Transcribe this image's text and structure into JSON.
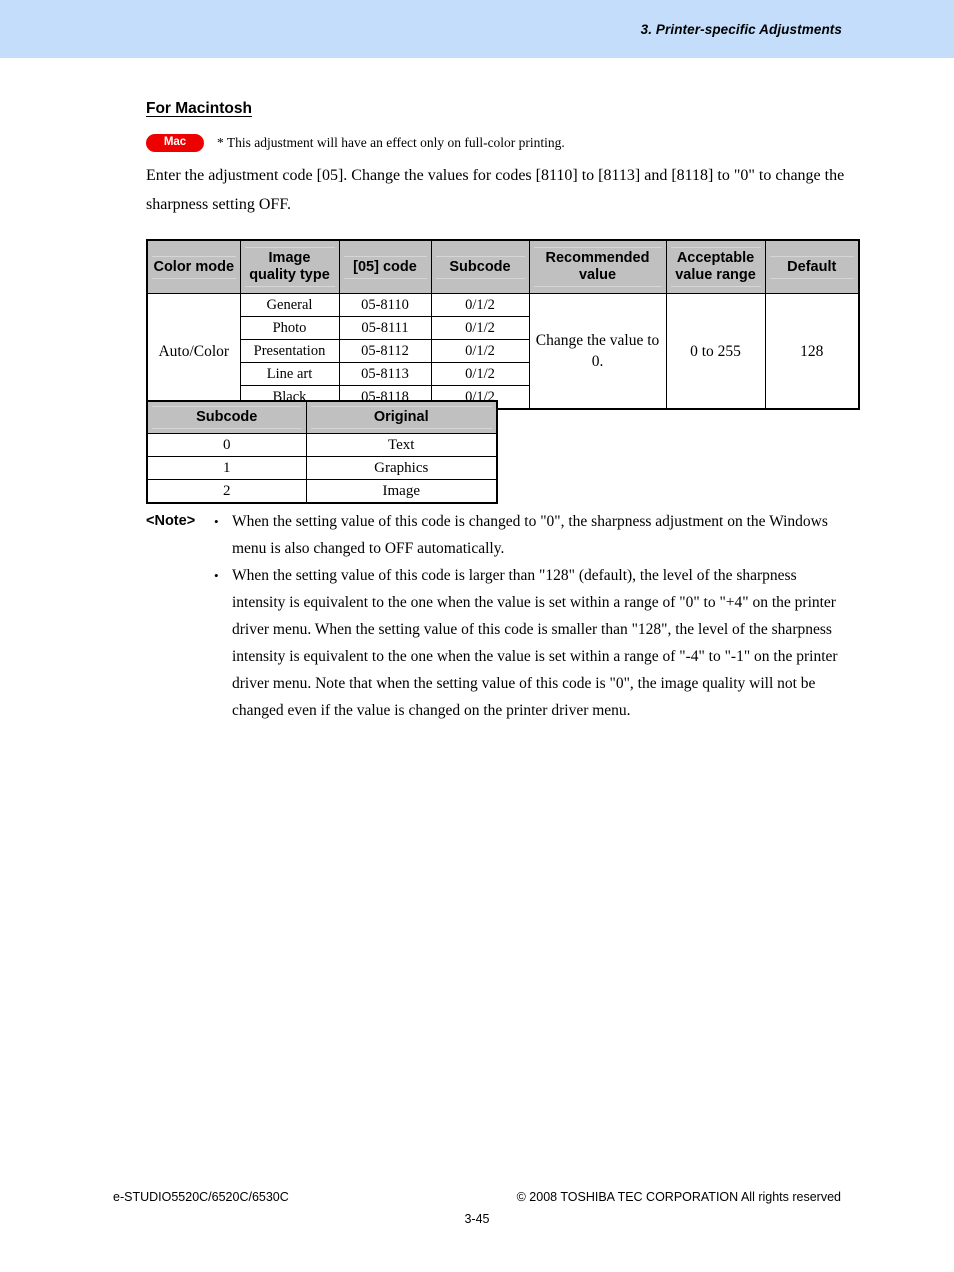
{
  "header": {
    "chapter_title": "3. Printer-specific Adjustments",
    "band_color": "#c3ddfb"
  },
  "section": {
    "heading": "For Macintosh",
    "badge_label": "Mac",
    "badge_color": "#ef0000",
    "badge_note": "* This adjustment will have an effect only on full-color printing.",
    "paragraph": "Enter the adjustment code [05]. Change the values for codes [8110] to [8113] and [8118] to \"0\" to change the sharpness setting OFF."
  },
  "main_table": {
    "headers": [
      "Color mode",
      "Image quality type",
      "[05] code",
      "Subcode",
      "Recommended value",
      "Acceptable value range",
      "Default"
    ],
    "header_bg": "#c0c0c0",
    "color_mode": "Auto/Color",
    "recommended_value": "Change the value to 0.",
    "acceptable_value_range": "0 to 255",
    "default": "128",
    "rows": [
      {
        "image_quality_type": "General",
        "code": "05-8110",
        "subcode": "0/1/2"
      },
      {
        "image_quality_type": "Photo",
        "code": "05-8111",
        "subcode": "0/1/2"
      },
      {
        "image_quality_type": "Presentation",
        "code": "05-8112",
        "subcode": "0/1/2"
      },
      {
        "image_quality_type": "Line art",
        "code": "05-8113",
        "subcode": "0/1/2"
      },
      {
        "image_quality_type": "Black",
        "code": "05-8118",
        "subcode": "0/1/2"
      }
    ]
  },
  "subcode_table": {
    "headers": [
      "Subcode",
      "Original"
    ],
    "header_bg": "#c0c0c0",
    "rows": [
      {
        "subcode": "0",
        "original": "Text"
      },
      {
        "subcode": "1",
        "original": "Graphics"
      },
      {
        "subcode": "2",
        "original": "Image"
      }
    ]
  },
  "note": {
    "label": "<Note>",
    "bullet_glyph": "•",
    "items": [
      "When the setting value of this code is changed to \"0\", the sharpness adjustment on the Windows menu is also changed to OFF automatically.",
      "When the setting value of this code is larger than \"128\" (default), the level of the sharpness intensity is equivalent to the one when the value is set within a range of \"0\" to \"+4\" on the printer driver menu. When the setting value of this code is smaller than \"128\", the level of the sharpness intensity is equivalent to the one when the value is set within a range of \"-4\" to \"-1\" on the printer driver menu. Note that when the setting value of this code is \"0\", the image quality will not be changed even if the value is changed on the printer driver menu."
    ]
  },
  "footer": {
    "model": "e-STUDIO5520C/6520C/6530C",
    "copyright": "© 2008 TOSHIBA TEC CORPORATION All rights reserved",
    "page_number": "3-45"
  }
}
